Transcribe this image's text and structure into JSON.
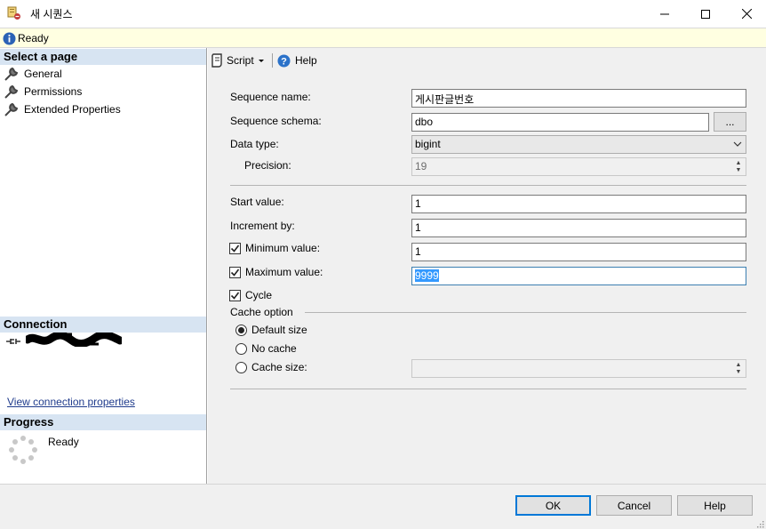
{
  "window": {
    "title": "새 시퀀스"
  },
  "status": {
    "text": "Ready"
  },
  "left": {
    "select_page_header": "Select a page",
    "pages": [
      {
        "label": "General"
      },
      {
        "label": "Permissions"
      },
      {
        "label": "Extended Properties"
      }
    ],
    "connection_header": "Connection",
    "view_connection_link": "View connection properties",
    "progress_header": "Progress",
    "progress_text": "Ready"
  },
  "toolbar": {
    "script_label": "Script",
    "help_label": "Help"
  },
  "form": {
    "sequence_name_label": "Sequence name:",
    "sequence_name_value": "게시판글번호",
    "sequence_schema_label": "Sequence schema:",
    "sequence_schema_value": "dbo",
    "browse_label": "...",
    "data_type_label": "Data type:",
    "data_type_value": "bigint",
    "precision_label": "Precision:",
    "precision_value": "19",
    "start_value_label": "Start value:",
    "start_value": "1",
    "increment_label": "Increment by:",
    "increment_value": "1",
    "minimum_label": "Minimum value:",
    "minimum_value": "1",
    "minimum_checked": true,
    "maximum_label": "Maximum value:",
    "maximum_value": "9999",
    "maximum_checked": true,
    "cycle_label": "Cycle",
    "cycle_checked": true,
    "cache_option_label": "Cache option",
    "cache_default_label": "Default size",
    "cache_none_label": "No cache",
    "cache_size_label": "Cache size:",
    "cache_selected": "Default size",
    "cache_size_value": ""
  },
  "buttons": {
    "ok": "OK",
    "cancel": "Cancel",
    "help": "Help"
  },
  "colors": {
    "accent": "#0078d7",
    "header_bg": "#d7e4f2",
    "status_bg": "#ffffe1",
    "selection": "#3399ff"
  }
}
